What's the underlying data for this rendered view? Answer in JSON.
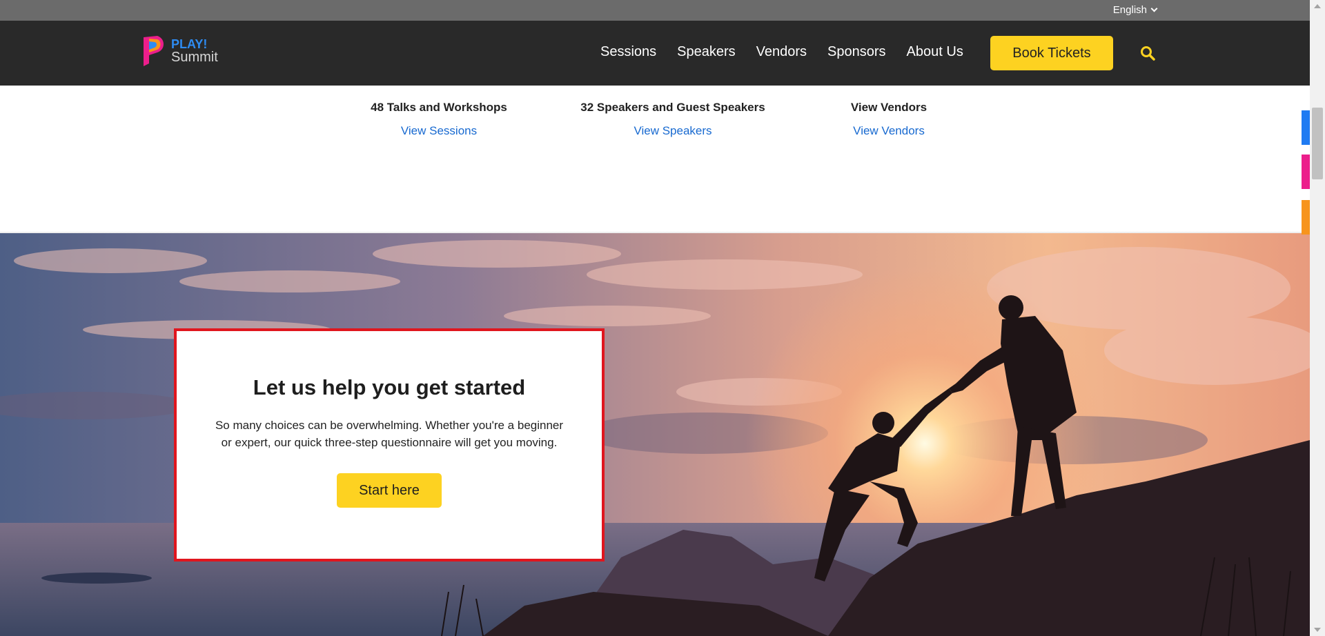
{
  "lang_bar": {
    "language": "English"
  },
  "header": {
    "logo_play": "PLAY!",
    "logo_summit": "Summit",
    "nav": [
      "Sessions",
      "Speakers",
      "Vendors",
      "Sponsors",
      "About Us"
    ],
    "book_label": "Book Tickets"
  },
  "stats": [
    {
      "title": "48 Talks and Workshops",
      "link": "View Sessions"
    },
    {
      "title": "32 Speakers and Guest Speakers",
      "link": "View Speakers"
    },
    {
      "title": "View Vendors",
      "link": "View Vendors"
    }
  ],
  "cta": {
    "title": "Let us help you get started",
    "text": "So many choices can be overwhelming. Whether you're a beginner or expert, our quick three-step questionnaire will get you moving.",
    "button": "Start here"
  },
  "colors": {
    "accent_yellow": "#fdd221",
    "link_blue": "#1769d0",
    "header_bg": "#292929",
    "card_border": "#e0161e"
  },
  "icons": [
    "chevron-down-icon",
    "logo-icon",
    "search-icon",
    "hero-image"
  ]
}
